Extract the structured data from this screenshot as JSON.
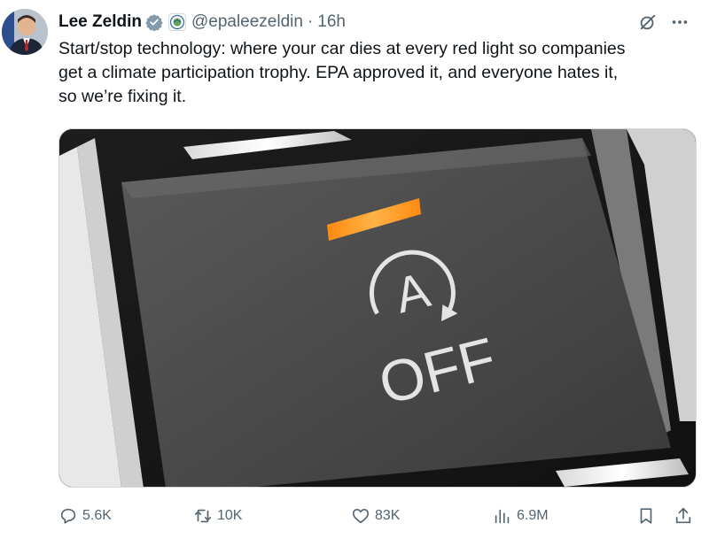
{
  "author": {
    "name": "Lee Zeldin",
    "handle": "@epaleezeldin",
    "separator": "·",
    "time": "16h"
  },
  "tweet": {
    "lines": [
      "Start/stop technology: where your car dies at every red light so companies",
      "get a climate participation trophy. EPA approved it, and everyone hates it,",
      "so we’re fixing it."
    ]
  },
  "media": {
    "button_symbol": "A",
    "button_label": "OFF",
    "indicator_color": "#ff9a1f"
  },
  "metrics": {
    "replies": "5.6K",
    "reposts": "10K",
    "likes": "83K",
    "views": "6.9M"
  },
  "icons": {
    "verified": "verified-badge-icon",
    "affiliation": "epa-seal-icon",
    "grok": "grok-icon",
    "more": "more-icon",
    "reply": "reply-icon",
    "repost": "repost-icon",
    "like": "heart-icon",
    "views": "views-icon",
    "bookmark": "bookmark-icon",
    "share": "share-icon"
  },
  "colors": {
    "text": "#0f1419",
    "secondary": "#536471",
    "verified_badge": "#829aab"
  }
}
